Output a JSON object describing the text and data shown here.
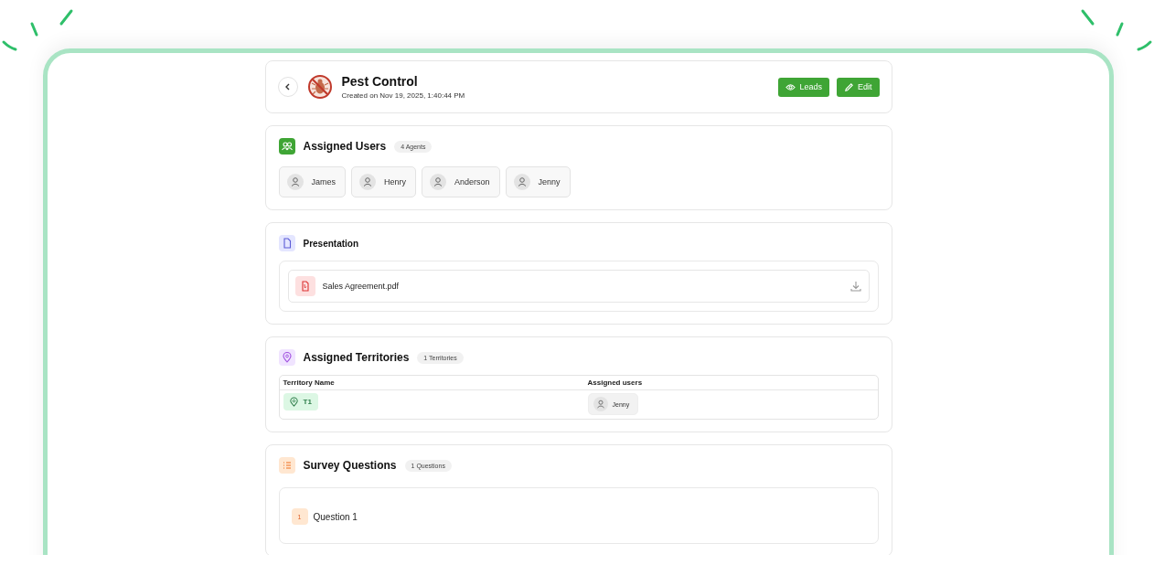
{
  "header": {
    "title": "Pest Control",
    "created": "Created on Nov 19, 2025, 1:40:44 PM",
    "buttons": [
      {
        "label": "Leads",
        "kind": "view"
      },
      {
        "label": "Edit",
        "kind": "edit"
      }
    ]
  },
  "assigned_users": {
    "title": "Assigned Users",
    "count": "4 Agents",
    "users": [
      "James",
      "Henry",
      "Anderson",
      "Jenny"
    ]
  },
  "presentation": {
    "title": "Presentation",
    "files": [
      {
        "name": "Sales Agreement.pdf"
      }
    ]
  },
  "territories": {
    "title": "Assigned Territories",
    "count": "1 Territories",
    "columns": [
      "Territory Name",
      "Assigned users"
    ],
    "rows": [
      {
        "name": "T1",
        "users": [
          "Jenny"
        ]
      }
    ]
  },
  "survey": {
    "title": "Survey Questions",
    "count": "1 Questions",
    "questions": [
      {
        "number": "1",
        "label": "Question 1"
      }
    ]
  }
}
